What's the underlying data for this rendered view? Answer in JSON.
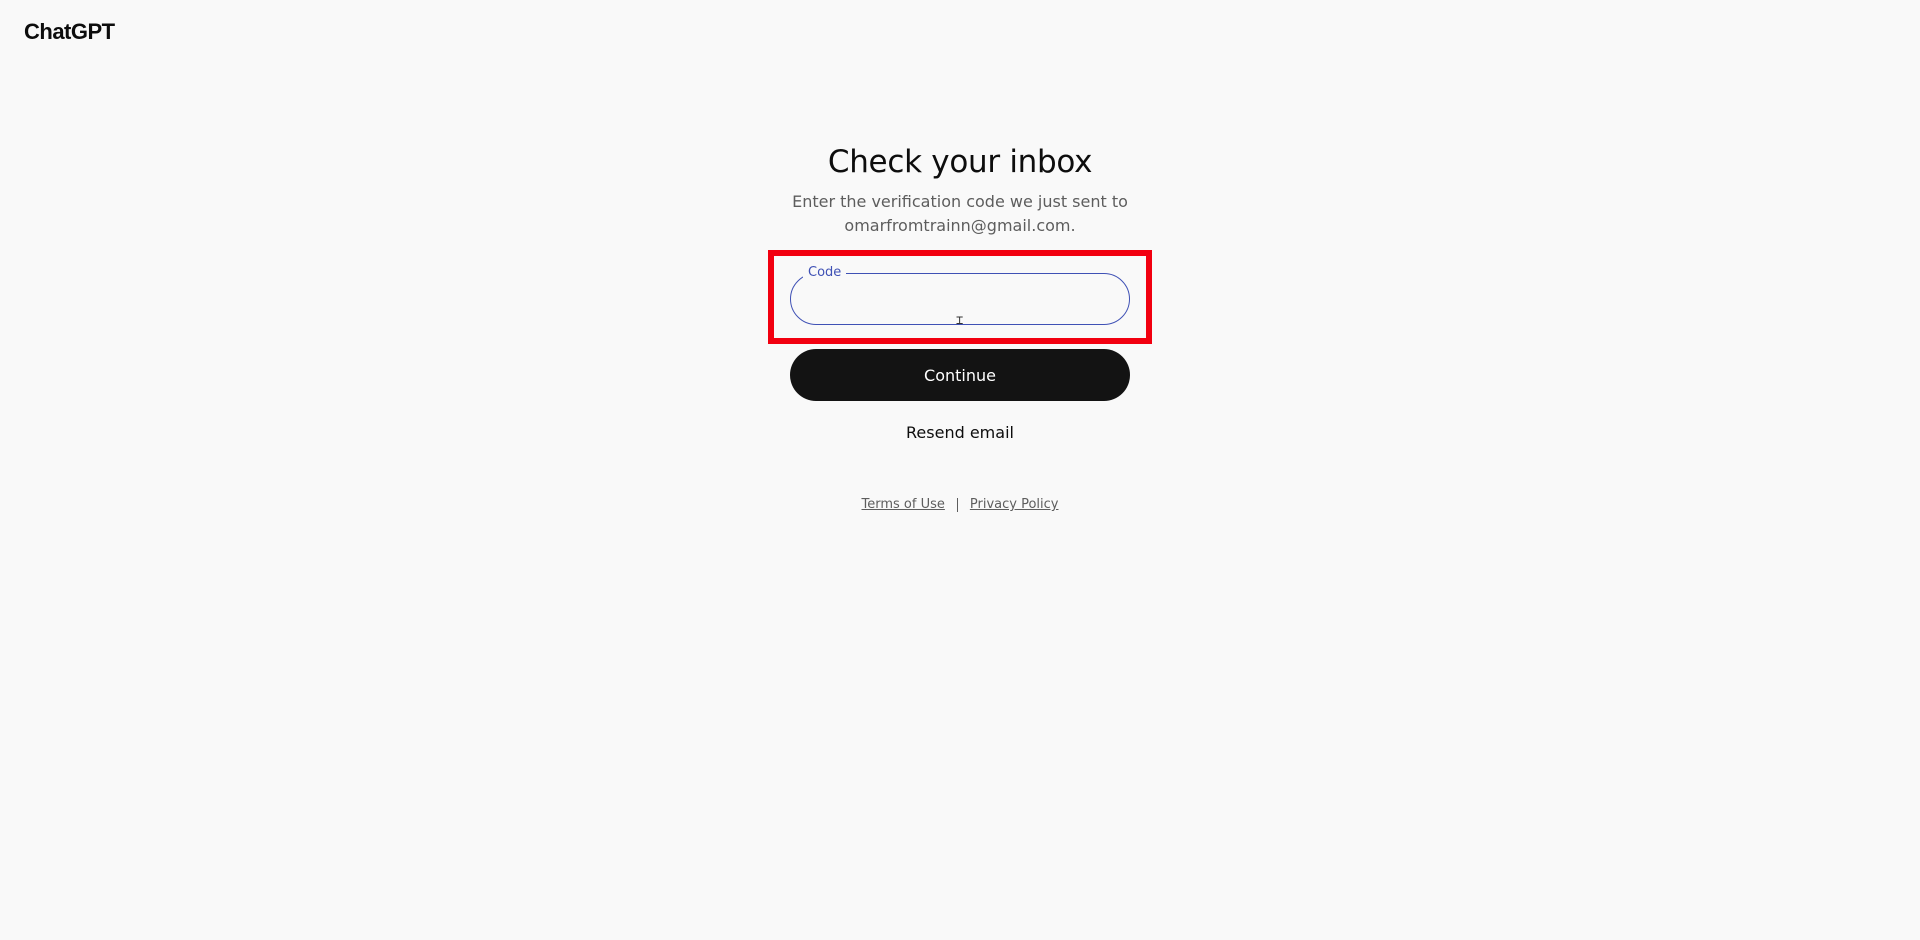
{
  "header": {
    "brand": "ChatGPT"
  },
  "main": {
    "title": "Check your inbox",
    "subtitle_line1": "Enter the verification code we just sent to",
    "subtitle_line2": "omarfromtrainn@gmail.com.",
    "code_field": {
      "label": "Code",
      "value": "",
      "placeholder": ""
    },
    "continue_label": "Continue",
    "resend_label": "Resend email"
  },
  "footer": {
    "terms_label": "Terms of Use",
    "privacy_label": "Privacy Policy"
  },
  "colors": {
    "background": "#f9f9f9",
    "primary_button": "#131313",
    "field_accent": "#3f51b5",
    "highlight": "#f20010",
    "muted_text": "#5d5d5d"
  },
  "icons": {
    "cursor": "text-cursor-icon"
  }
}
